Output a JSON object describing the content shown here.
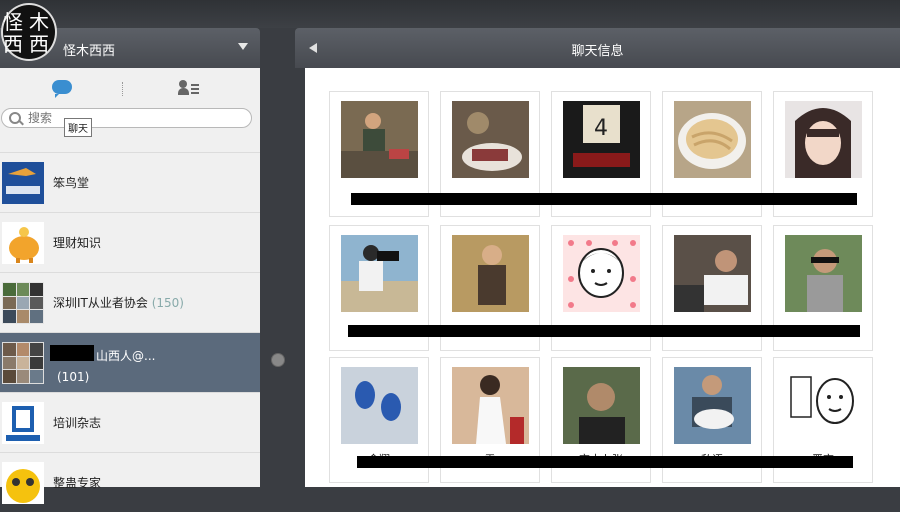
{
  "user": {
    "avatar_text_top": "怪木",
    "avatar_text_bottom": "西西",
    "name": "怪木西西"
  },
  "left_tabs": {
    "tooltip": "聊天"
  },
  "search": {
    "placeholder": "搜索"
  },
  "conversations": [
    {
      "name": "笨鸟堂",
      "count": ""
    },
    {
      "name": "理财知识",
      "count": ""
    },
    {
      "name": "深圳IT从业者协会",
      "count": "(150)"
    },
    {
      "name": "山西人@...",
      "count": "(101)",
      "active": true
    },
    {
      "name": "培训杂志",
      "count": ""
    },
    {
      "name": "整蛊专家",
      "count": ""
    }
  ],
  "right": {
    "title": "聊天信息"
  },
  "members": [
    {
      "caption": ""
    },
    {
      "caption": ""
    },
    {
      "caption": ""
    },
    {
      "caption": ""
    },
    {
      "caption": ""
    },
    {
      "caption": ""
    },
    {
      "caption": ""
    },
    {
      "caption": ""
    },
    {
      "caption": ""
    },
    {
      "caption": ""
    },
    {
      "caption": "金翔"
    },
    {
      "caption": "雪"
    },
    {
      "caption": "京十卜张"
    },
    {
      "caption": "私语"
    },
    {
      "caption": "晋京"
    }
  ],
  "colors": {
    "accent": "#3a8ed0",
    "active_row": "#5b6a7c",
    "header": "#505358"
  }
}
